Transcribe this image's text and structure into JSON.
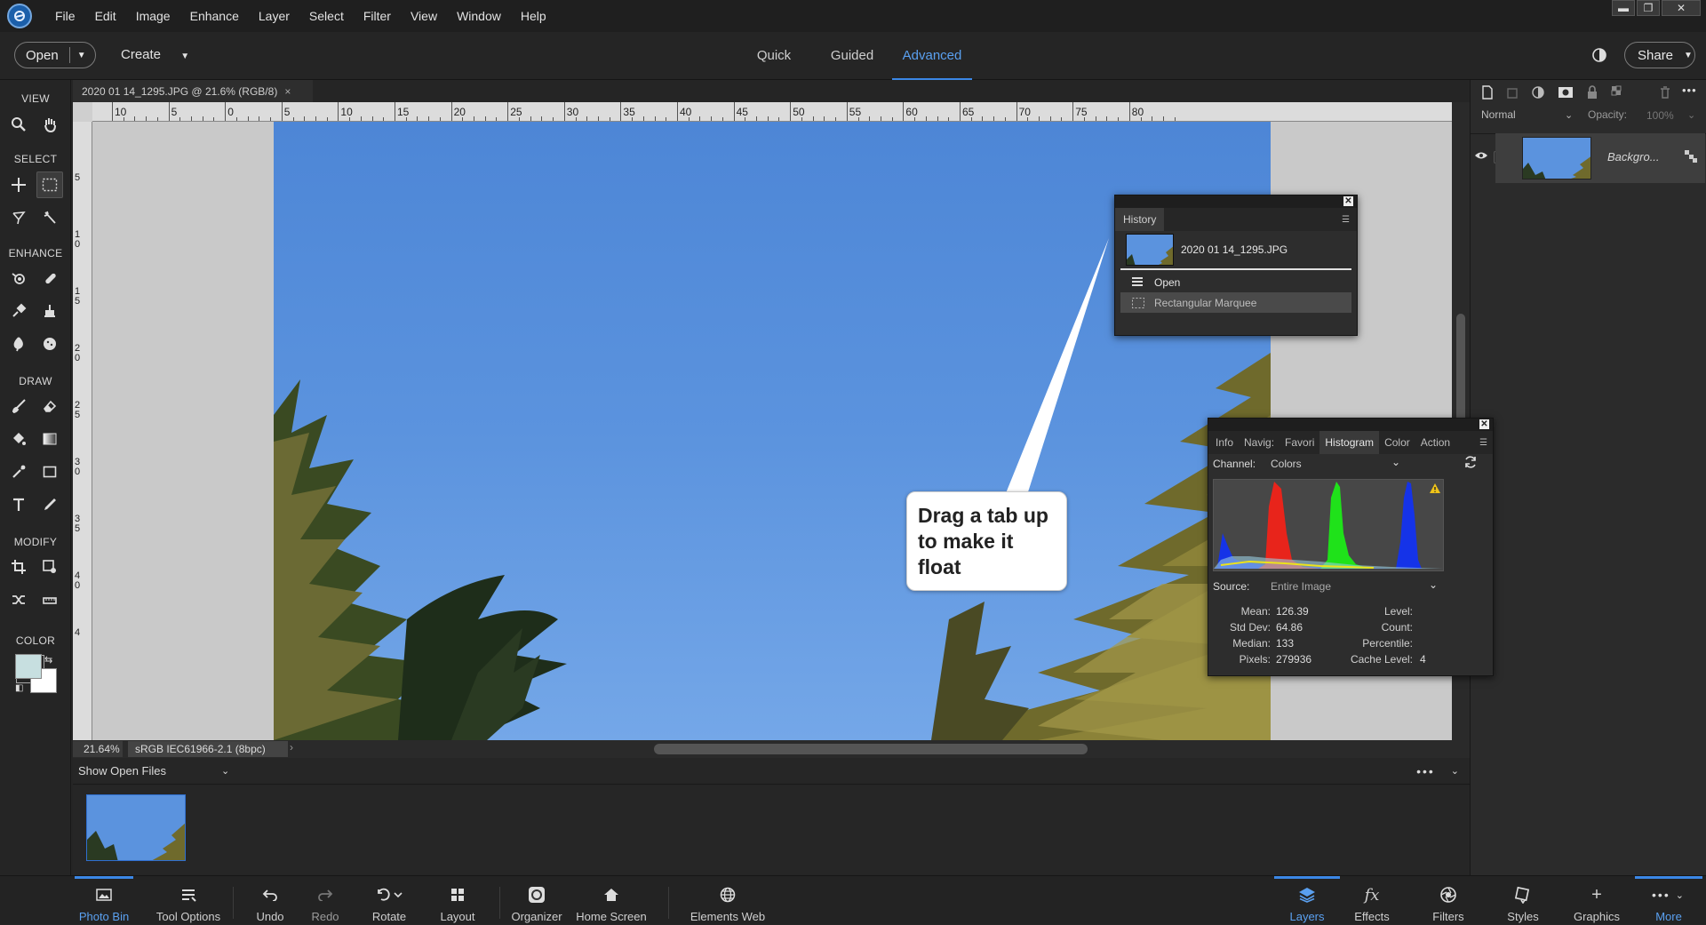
{
  "menu": {
    "items": [
      "File",
      "Edit",
      "Image",
      "Enhance",
      "Layer",
      "Select",
      "Filter",
      "View",
      "Window",
      "Help"
    ]
  },
  "window_controls": {
    "minimize": "▬",
    "restore": "❐",
    "close": "✕"
  },
  "modebar": {
    "open_label": "Open",
    "create_label": "Create",
    "tabs": [
      "Quick",
      "Guided",
      "Advanced"
    ],
    "active_tab": "Advanced",
    "share_label": "Share"
  },
  "toolbox": {
    "sections": [
      "VIEW",
      "SELECT",
      "ENHANCE",
      "DRAW",
      "MODIFY",
      "COLOR"
    ],
    "foreground_color": "#c7dfe0",
    "background_color": "#ffffff"
  },
  "document": {
    "tab_title": "2020 01 14_1295.JPG @ 21.6% (RGB/8)",
    "close_glyph": "×",
    "ruler_top": [
      "10",
      "5",
      "0",
      "5",
      "10",
      "15",
      "20",
      "25",
      "30",
      "35",
      "40",
      "45",
      "50",
      "55",
      "60",
      "65",
      "70",
      "75",
      "80"
    ],
    "ruler_left": [
      "5",
      "10",
      "15",
      "20",
      "25",
      "30",
      "35",
      "40",
      "4"
    ],
    "zoom": "21.64%",
    "profile": "sRGB IEC61966-2.1 (8bpc)"
  },
  "photo_bin": {
    "dropdown_label": "Show Open Files"
  },
  "history": {
    "title": "History",
    "snapshot_name": "2020 01 14_1295.JPG",
    "steps": [
      "Open",
      "Rectangular Marquee"
    ]
  },
  "callout": {
    "text": "Drag a tab up to make it float"
  },
  "histogram": {
    "tabs": [
      "Info",
      "Navig:",
      "Favori",
      "Histogram",
      "Color",
      "Action"
    ],
    "active_tab": "Histogram",
    "channel_label": "Channel:",
    "channel_value": "Colors",
    "source_label": "Source:",
    "source_value": "Entire Image",
    "stats_left": [
      {
        "label": "Mean:",
        "value": "126.39"
      },
      {
        "label": "Std Dev:",
        "value": "64.86"
      },
      {
        "label": "Median:",
        "value": "133"
      },
      {
        "label": "Pixels:",
        "value": "279936"
      }
    ],
    "stats_right": [
      {
        "label": "Level:",
        "value": ""
      },
      {
        "label": "Count:",
        "value": ""
      },
      {
        "label": "Percentile:",
        "value": ""
      },
      {
        "label": "Cache Level:",
        "value": "4"
      }
    ],
    "colors": {
      "red": "#e8241b",
      "green": "#1fe21a",
      "blue": "#1533e8"
    }
  },
  "layers_panel": {
    "blend_mode": "Normal",
    "opacity_label": "Opacity:",
    "opacity_value": "100%",
    "layer_name": "Backgro..."
  },
  "taskbar": {
    "left": [
      "Photo Bin",
      "Tool Options",
      "Undo",
      "Redo",
      "Rotate",
      "Layout",
      "Organizer",
      "Home Screen",
      "Elements Web"
    ],
    "right": [
      "Layers",
      "Effects",
      "Filters",
      "Styles",
      "Graphics",
      "More"
    ],
    "active_left": "Photo Bin",
    "active_right": "Layers"
  }
}
